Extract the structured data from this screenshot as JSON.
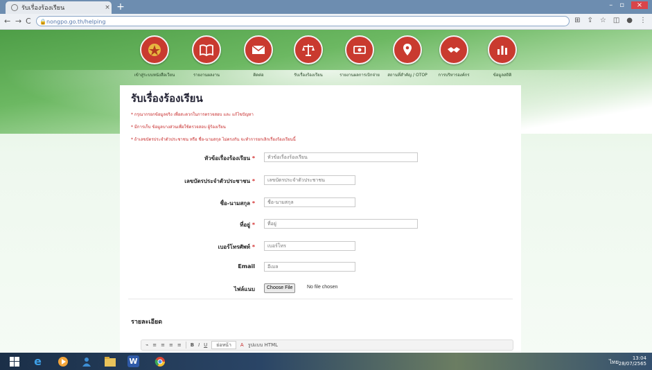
{
  "browser": {
    "tab_title": "รับเรื่องร้องเรียน",
    "tab_close": "×",
    "new_tab": "+",
    "url": "nongpo.go.th/helping",
    "win_min": "–",
    "win_max": "▫",
    "win_close": "×",
    "nav_back": "←",
    "nav_forward": "→",
    "nav_reload": "C",
    "lock": "🔒",
    "tool_translate": "⊞",
    "tool_share": "⇪",
    "tool_star": "☆",
    "tool_sidebar": "◫",
    "tool_profile": "●",
    "tool_menu": "⋮"
  },
  "menu": {
    "items": [
      {
        "label": "เข้าสู่ระบบหนังสือเวียน",
        "icon": "emblem-icon"
      },
      {
        "label": "รายงานผลงาน",
        "icon": "book-icon"
      },
      {
        "label": "ติดต่อ",
        "icon": "mail-icon"
      },
      {
        "label": "รับเรื่องร้องเรียน",
        "icon": "scales-icon"
      },
      {
        "label": "รายงานผลการเบิกจ่าย",
        "icon": "money-icon"
      },
      {
        "label": "สถานที่สำคัญ / OTOP",
        "icon": "location-pin-icon"
      },
      {
        "label": "การบริหารองค์กร",
        "icon": "handshake-icon"
      },
      {
        "label": "ข้อมูลสถิติ",
        "icon": "bar-chart-icon"
      }
    ]
  },
  "page": {
    "title": "รับเรื่องร้องเรียน",
    "notes": [
      "* กรุณากรอกข้อมูลจริง เพื่อสะดวกในการตรวจสอบ และ แก้ไขปัญหา",
      "* มีการเก็บ ข้อมูลบางส่วนเพื่อใช้ตรวจสอบ ผู้ร้องเรียน",
      "* ถ้าเลขบัตรประจำตัวประชาชน หรือ ชื่อ-นามสกุล ไม่ตรงกัน จะทำการยกเลิกเรื่องร้องเรียนนี้"
    ]
  },
  "form": {
    "subject": {
      "label": "หัวข้อเรื่องร้องเรียน",
      "req": "*",
      "placeholder": "หัวข้อเรื่องร้องเรียน"
    },
    "idcard": {
      "label": "เลขบัตรประจำตัวประชาชน",
      "req": "*",
      "placeholder": "เลขบัตรประจำตัวประชาชน"
    },
    "name": {
      "label": "ชื่อ-นามสกุล",
      "req": "*",
      "placeholder": "ชื่อ-นามสกุล"
    },
    "address": {
      "label": "ที่อยู่",
      "req": "*",
      "placeholder": "ที่อยู่"
    },
    "phone": {
      "label": "เบอร์โทรศัพท์",
      "req": "*",
      "placeholder": "เบอร์โทร"
    },
    "email": {
      "label": "Email",
      "placeholder": "อีเมล"
    },
    "attachment": {
      "label": "ไฟล์แนบ",
      "button": "Choose File",
      "status": "No file chosen"
    }
  },
  "details": {
    "label": "รายละเอียด",
    "toolbar": {
      "bold": "B",
      "italic": "I",
      "underline": "U",
      "format": "ย่อหน้า",
      "font_color": "A",
      "html": "รูปแบบ HTML"
    }
  },
  "taskbar": {
    "time": "13:04",
    "date": "28/07/2565",
    "tray_text": "ไทย"
  },
  "colors": {
    "accent_red": "#c93a2f",
    "required_red": "#d32f2f",
    "header_green": "#4e9e47"
  }
}
